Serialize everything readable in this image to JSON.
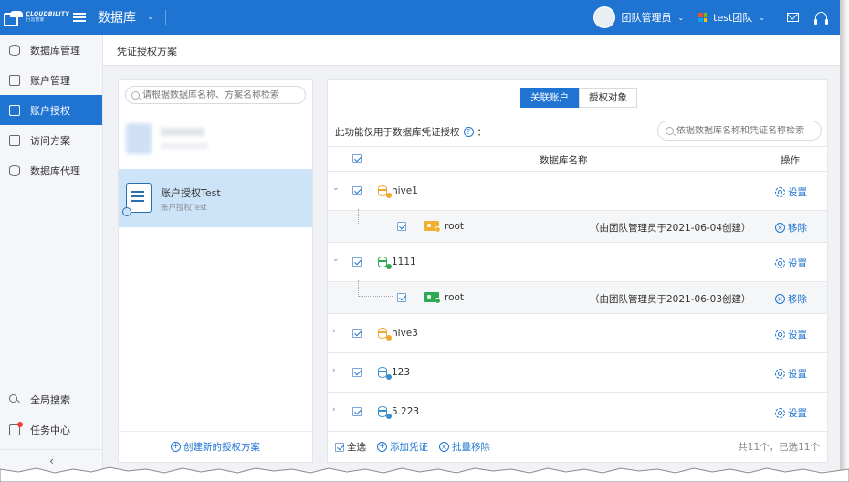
{
  "topbar": {
    "logo_text": "CLOUDBILITY",
    "logo_sub": "行云管家",
    "app_name": "数据库",
    "app_chevron": "⌄",
    "user_name": "团队管理员",
    "team_name": "test团队",
    "caret": "⌄"
  },
  "sidebar": {
    "items": [
      {
        "label": "数据库管理",
        "icon": "database-icon"
      },
      {
        "label": "账户管理",
        "icon": "account-card-icon"
      },
      {
        "label": "账户授权",
        "icon": "authorize-icon",
        "active": true
      },
      {
        "label": "访问方案",
        "icon": "clipboard-icon"
      },
      {
        "label": "数据库代理",
        "icon": "database-proxy-icon"
      }
    ],
    "bottom_items": [
      {
        "label": "全局搜索",
        "icon": "search-icon"
      },
      {
        "label": "任务中心",
        "icon": "task-icon"
      }
    ],
    "collapse_glyph": "‹"
  },
  "breadcrumb": "凭证授权方案",
  "left_panel": {
    "search_placeholder": "请根据数据库名称、方案名称检索",
    "selected_plan": {
      "title": "账户授权Test",
      "subtitle": "账户授权Test"
    },
    "create_label": "创建新的授权方案"
  },
  "right_panel": {
    "tabs": [
      "关联账户",
      "授权对象"
    ],
    "active_tab": 0,
    "hint": "此功能仅用于数据库凭证授权",
    "hint_suffix": "：",
    "search_placeholder": "依据数据库名称和凭证名称检索",
    "columns": {
      "name": "数据库名称",
      "op": "操作"
    },
    "rows": [
      {
        "name": "hive1",
        "expanded": true,
        "color": "#f0a92e",
        "dot": "#f0a92e",
        "op": "设置",
        "child": {
          "name": "root",
          "created": "（由团队管理员于2021-06-04创建）",
          "color": "#f0b132",
          "op": "移除"
        }
      },
      {
        "name": "1111",
        "expanded": true,
        "color": "#33a853",
        "dot": "#33a853",
        "op": "设置",
        "child": {
          "name": "root",
          "created": "（由团队管理员于2021-06-03创建）",
          "color": "#2fa84f",
          "op": "移除"
        }
      },
      {
        "name": "hive3",
        "expanded": false,
        "color": "#f0a92e",
        "dot": "#f0a92e",
        "op": "设置"
      },
      {
        "name": "123",
        "expanded": false,
        "color": "#3a8fc9",
        "dot": "#3a8fc9",
        "op": "设置"
      },
      {
        "name": "5.223",
        "expanded": false,
        "color": "#3a8fc9",
        "dot": "#3a8fc9",
        "op": "设置"
      }
    ],
    "footer": {
      "select_all": "全选",
      "add": "添加凭证",
      "batch_remove": "批量移除",
      "count": "共11个，已选11个"
    }
  },
  "colors": {
    "primary": "#1f74d2",
    "selected_bg": "#cde4f8"
  }
}
